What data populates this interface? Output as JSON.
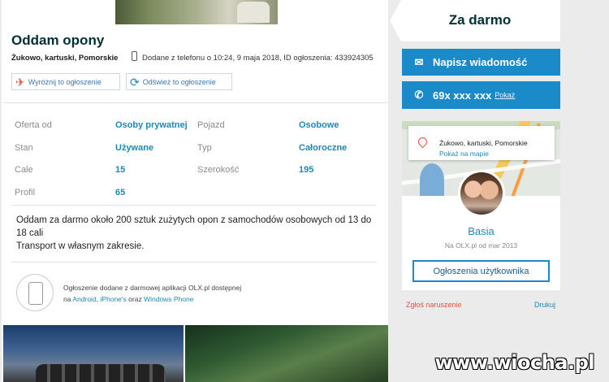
{
  "ad": {
    "title": "Oddam opony",
    "location": "Żukowo, kartuski, Pomorskie",
    "added_info": "Dodane z telefonu   o 10:24, 9 maja 2018, ID ogłoszenia: 433924305",
    "promote_label": "Wyróżnij to ogłoszenie",
    "refresh_label": "Odśwież to ogłoszenie"
  },
  "params": [
    {
      "label": "Oferta od",
      "value": "Osoby prywatnej"
    },
    {
      "label": "Pojazd",
      "value": "Osobowe"
    },
    {
      "label": "Stan",
      "value": "Używane"
    },
    {
      "label": "Typ",
      "value": "Całoroczne"
    },
    {
      "label": "Cale",
      "value": "15"
    },
    {
      "label": "Szerokość",
      "value": "195"
    },
    {
      "label": "Profil",
      "value": "65"
    }
  ],
  "description": {
    "line1": "Oddam za darmo około 200 sztuk zużytych opon z samochodów osobowych od 13 do 18 cali",
    "line2": "Transport w własnym zakresie."
  },
  "app_info": {
    "line1": "Ogłoszenie dodane z darmowej aplikacji OLX.pl dostępnej",
    "na": "na",
    "android": "Android",
    "comma": ",",
    "iphone": "iPhone's",
    "oraz": "oraz",
    "windows": "Windows Phone"
  },
  "sidebar": {
    "price": "Za darmo",
    "message_label": "Napisz wiadomość",
    "phone_number": "69x xxx xxx",
    "show_label": "Pokaż",
    "map_location": "Żukowo, kartuski, Pomorskie",
    "map_link": "Pokaż na mapie",
    "user_name": "Basia",
    "user_since": "Na OLX.pl od mar 2013",
    "user_ads_label": "Ogłoszenia użytkownika",
    "report_label": "Zgłoś naruszenie",
    "print_label": "Drukuj"
  },
  "watermark": "www.wiocha.pl",
  "colors": {
    "accent": "#1b8ac9",
    "link": "#1e88b4",
    "report": "#e0533b"
  },
  "icons": {
    "phone_small": "phone-icon",
    "promote": "kite-icon",
    "refresh": "refresh-icon",
    "message": "envelope-icon",
    "call": "phone-icon",
    "map_pin": "map-pin-icon",
    "app": "smartphone-icon"
  }
}
